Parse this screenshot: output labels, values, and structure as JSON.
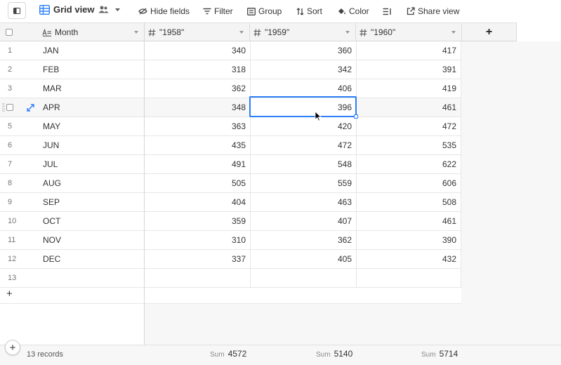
{
  "toolbar": {
    "view_name": "Grid view",
    "hide_fields": "Hide fields",
    "filter": "Filter",
    "group": "Group",
    "sort": "Sort",
    "color": "Color",
    "share_view": "Share view",
    "accent": "#2d7ff9"
  },
  "columns": {
    "primary": "Month",
    "c1958": "\"1958\"",
    "c1959": "\"1959\"",
    "c1960": "\"1960\"",
    "add": "+"
  },
  "rows": [
    {
      "n": "1",
      "month": "JAN",
      "v1958": "340",
      "v1959": "360",
      "v1960": "417"
    },
    {
      "n": "2",
      "month": "FEB",
      "v1958": "318",
      "v1959": "342",
      "v1960": "391"
    },
    {
      "n": "3",
      "month": "MAR",
      "v1958": "362",
      "v1959": "406",
      "v1960": "419"
    },
    {
      "n": "",
      "month": "APR",
      "v1958": "348",
      "v1959": "396",
      "v1960": "461"
    },
    {
      "n": "5",
      "month": "MAY",
      "v1958": "363",
      "v1959": "420",
      "v1960": "472"
    },
    {
      "n": "6",
      "month": "JUN",
      "v1958": "435",
      "v1959": "472",
      "v1960": "535"
    },
    {
      "n": "7",
      "month": "JUL",
      "v1958": "491",
      "v1959": "548",
      "v1960": "622"
    },
    {
      "n": "8",
      "month": "AUG",
      "v1958": "505",
      "v1959": "559",
      "v1960": "606"
    },
    {
      "n": "9",
      "month": "SEP",
      "v1958": "404",
      "v1959": "463",
      "v1960": "508"
    },
    {
      "n": "10",
      "month": "OCT",
      "v1958": "359",
      "v1959": "407",
      "v1960": "461"
    },
    {
      "n": "11",
      "month": "NOV",
      "v1958": "310",
      "v1959": "362",
      "v1960": "390"
    },
    {
      "n": "12",
      "month": "DEC",
      "v1958": "337",
      "v1959": "405",
      "v1960": "432"
    },
    {
      "n": "13",
      "month": "",
      "v1958": "",
      "v1959": "",
      "v1960": ""
    }
  ],
  "add_row": "+",
  "footer": {
    "add": "+",
    "record_count": "13 records",
    "sum_label": "Sum",
    "sum_1958": "4572",
    "sum_1959": "5140",
    "sum_1960": "5714"
  }
}
